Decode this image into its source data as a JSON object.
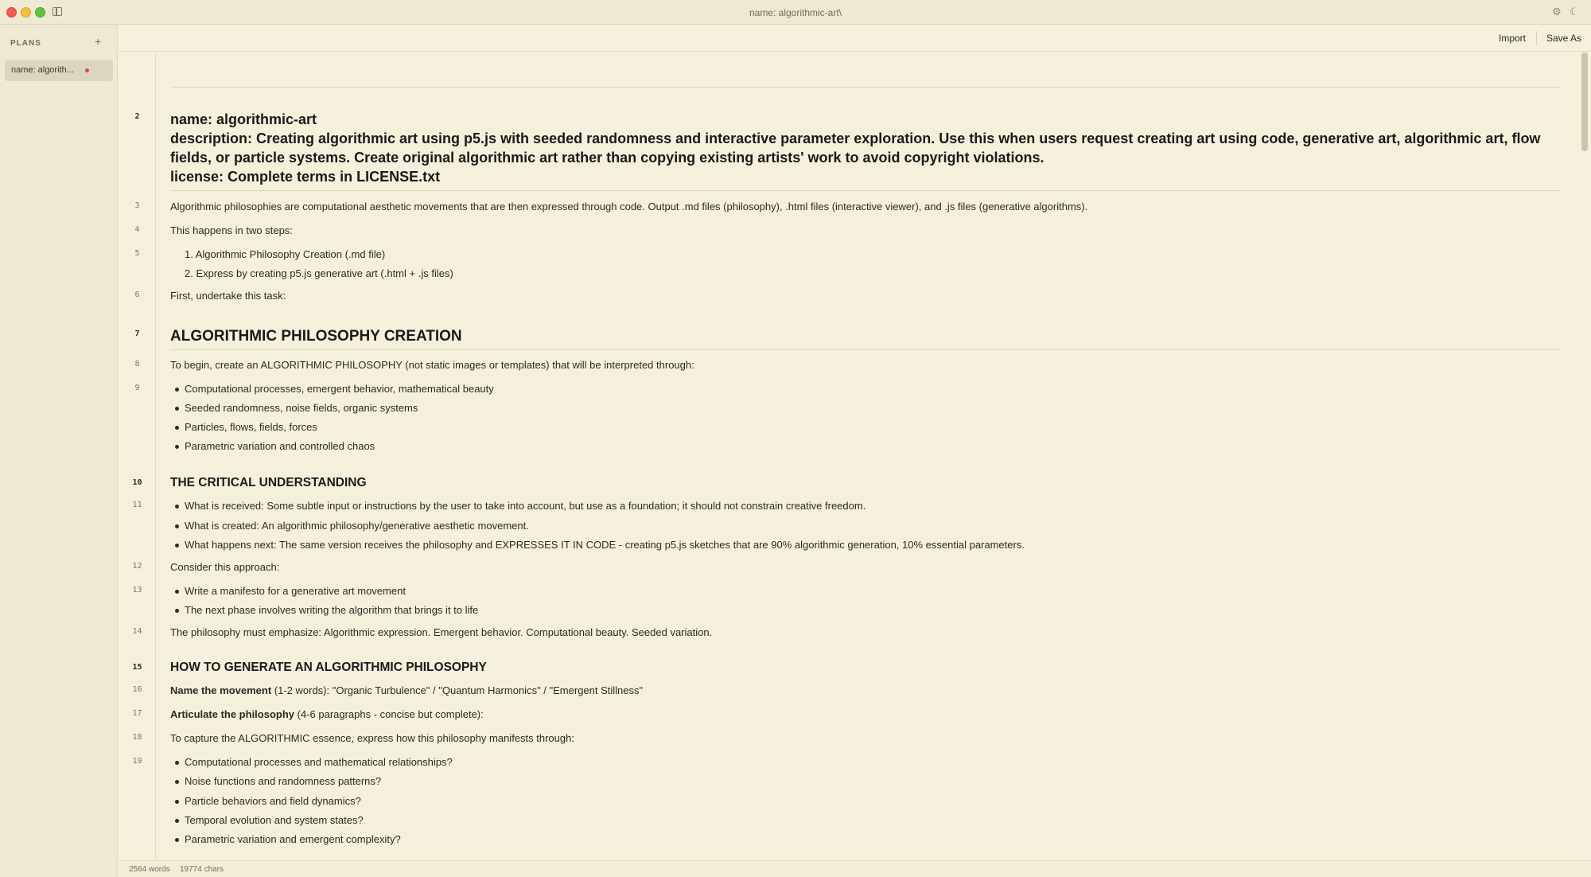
{
  "window": {
    "title": "name: algorithmic-art\\"
  },
  "sidebar": {
    "header": "PLANS",
    "add_icon": "plus-icon",
    "items": [
      {
        "label": "name: algorith...",
        "unsaved": true
      }
    ]
  },
  "toolbar": {
    "import_label": "Import",
    "save_as_label": "Save As"
  },
  "icons": {
    "settings": "gear-icon",
    "theme": "moon-icon",
    "sidebar": "sidebar-toggle-icon"
  },
  "editor": {
    "line_numbers": {
      "l2": "2",
      "l3": "3",
      "l4": "4",
      "l5": "5",
      "l6": "6",
      "l7": "7",
      "l8": "8",
      "l9": "9",
      "l10": "10",
      "l11": "11",
      "l12": "12",
      "l13": "13",
      "l14": "14",
      "l15": "15",
      "l16": "16",
      "l17": "17",
      "l18": "18",
      "l19": "19"
    },
    "frontmatter": {
      "name": "name: algorithmic-art",
      "description": "description: Creating algorithmic art using p5.js with seeded randomness and interactive parameter exploration. Use this when users request creating art using code, generative art, algorithmic art, flow fields, or particle systems. Create original algorithmic art rather than copying existing artists' work to avoid copyright violations.",
      "license": "license: Complete terms in LICENSE.txt"
    },
    "intro": "Algorithmic philosophies are computational aesthetic movements that are then expressed through code. Output .md files (philosophy), .html files (interactive viewer), and .js files (generative algorithms).",
    "two_steps": "This happens in two steps:",
    "steps": [
      "1. Algorithmic Philosophy Creation (.md file)",
      "2. Express by creating p5.js generative art (.html + .js files)"
    ],
    "first_task": "First, undertake this task:",
    "heading_creation": "ALGORITHMIC PHILOSOPHY CREATION",
    "to_begin": "To begin, create an ALGORITHMIC PHILOSOPHY (not static images or templates) that will be interpreted through:",
    "begin_list": [
      "Computational processes, emergent behavior, mathematical beauty",
      "Seeded randomness, noise fields, organic systems",
      "Particles, flows, fields, forces",
      "Parametric variation and controlled chaos"
    ],
    "heading_critical": "THE CRITICAL UNDERSTANDING",
    "critical_list": [
      "What is received: Some subtle input or instructions by the user to take into account, but use as a foundation; it should not constrain creative freedom.",
      "What is created: An algorithmic philosophy/generative aesthetic movement.",
      "What happens next: The same version receives the philosophy and EXPRESSES IT IN CODE - creating p5.js sketches that are 90% algorithmic generation, 10% essential parameters."
    ],
    "consider": "Consider this approach:",
    "consider_list": [
      "Write a manifesto for a generative art movement",
      "The next phase involves writing the algorithm that brings it to life"
    ],
    "emphasize": "The philosophy must emphasize: Algorithmic expression. Emergent behavior. Computational beauty. Seeded variation.",
    "heading_how": "HOW TO GENERATE AN ALGORITHMIC PHILOSOPHY",
    "name_movement_bold": "Name the movement",
    "name_movement_rest": " (1-2 words): \"Organic Turbulence\" / \"Quantum Harmonics\" / \"Emergent Stillness\"",
    "articulate_bold": "Articulate the philosophy",
    "articulate_rest": " (4-6 paragraphs - concise but complete):",
    "capture": "To capture the ALGORITHMIC essence, express how this philosophy manifests through:",
    "capture_list": [
      "Computational processes and mathematical relationships?",
      "Noise functions and randomness patterns?",
      "Particle behaviors and field dynamics?",
      "Temporal evolution and system states?",
      "Parametric variation and emergent complexity?"
    ]
  },
  "status": {
    "words": "2564 words",
    "chars": "19774 chars"
  }
}
